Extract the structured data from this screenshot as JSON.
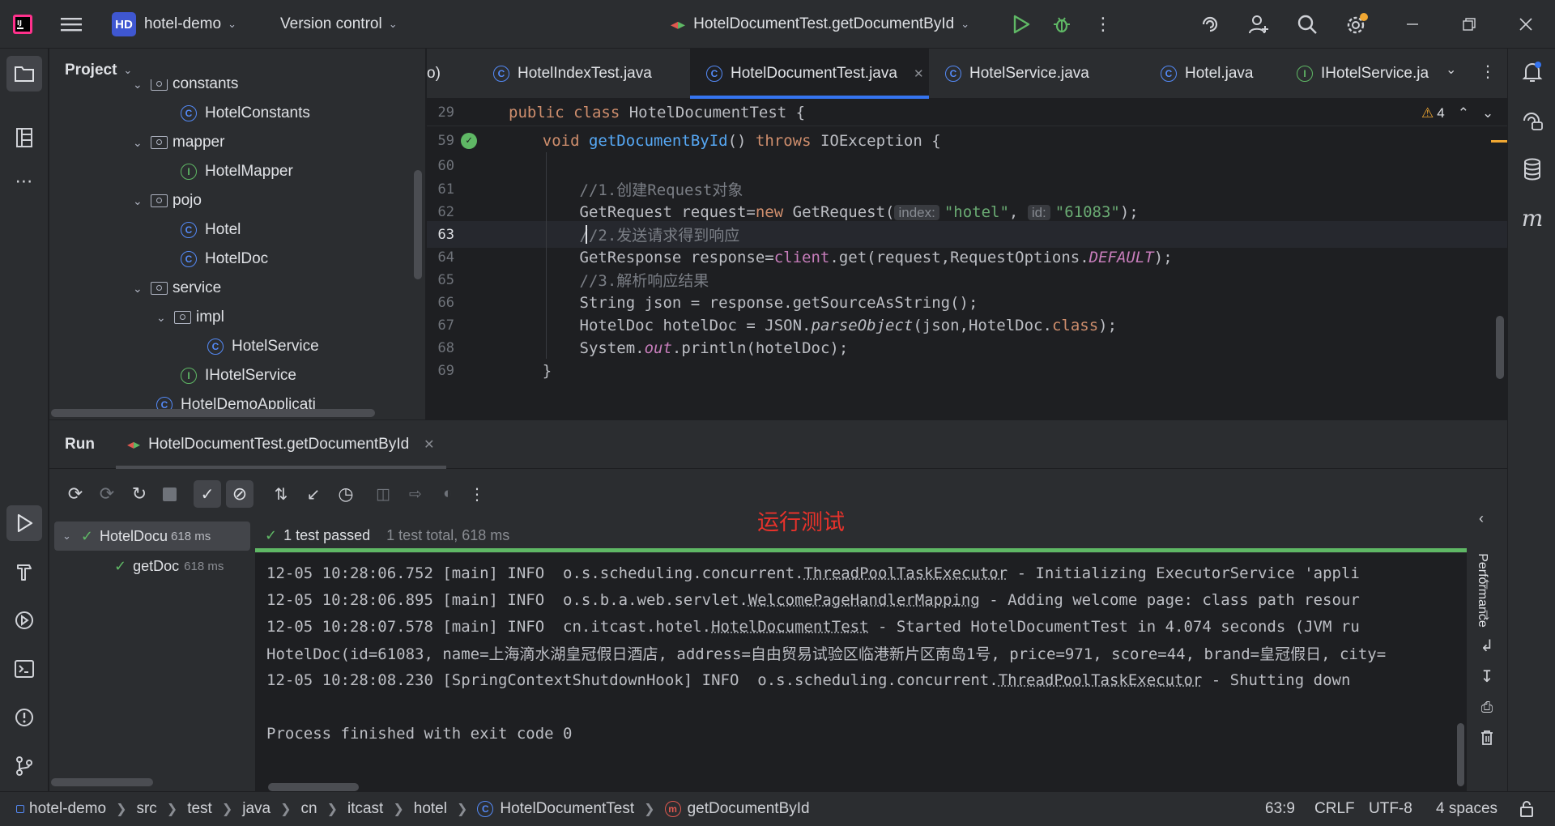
{
  "titlebar": {
    "project_badge": "HD",
    "project_name": "hotel-demo",
    "vcs_label": "Version control",
    "run_config": "HotelDocumentTest.getDocumentById"
  },
  "project_panel": {
    "title": "Project",
    "items": [
      {
        "label": "constants",
        "type": "folder",
        "indent": 0
      },
      {
        "label": "HotelConstants",
        "type": "class",
        "indent": 1
      },
      {
        "label": "mapper",
        "type": "folder",
        "indent": 0
      },
      {
        "label": "HotelMapper",
        "type": "interface",
        "indent": 1
      },
      {
        "label": "pojo",
        "type": "folder",
        "indent": 0
      },
      {
        "label": "Hotel",
        "type": "class",
        "indent": 1
      },
      {
        "label": "HotelDoc",
        "type": "class",
        "indent": 1
      },
      {
        "label": "service",
        "type": "folder",
        "indent": 0
      },
      {
        "label": "impl",
        "type": "folder",
        "indent": 1
      },
      {
        "label": "HotelService",
        "type": "class",
        "indent": 2
      },
      {
        "label": "IHotelService",
        "type": "interface",
        "indent": 1
      },
      {
        "label": "HotelDemoApplicati",
        "type": "class",
        "indent": 0
      }
    ]
  },
  "editor": {
    "tabs": [
      {
        "label": "o)"
      },
      {
        "label": "HotelIndexTest.java"
      },
      {
        "label": "HotelDocumentTest.java",
        "active": true
      },
      {
        "label": "HotelService.java"
      },
      {
        "label": "Hotel.java"
      },
      {
        "label": "IHotelService.ja"
      }
    ],
    "warnings_count": "4",
    "sticky_line": {
      "num": "29",
      "code": "public class HotelDocumentTest {"
    },
    "lines": [
      {
        "num": "59"
      },
      {
        "num": "60"
      },
      {
        "num": "61"
      },
      {
        "num": "62"
      },
      {
        "num": "63"
      },
      {
        "num": "64"
      },
      {
        "num": "65"
      },
      {
        "num": "66"
      },
      {
        "num": "67"
      },
      {
        "num": "68"
      },
      {
        "num": "69"
      }
    ],
    "code": {
      "l59_kw": "void",
      "l59_fn": "getDocumentById",
      "l59_rest1": "() ",
      "l59_throws": "throws",
      "l59_rest2": " IOException {",
      "l61": "//1.创建Request对象",
      "l62_a": "GetRequest request=",
      "l62_new": "new",
      "l62_b": " GetRequest(",
      "l62_hint1": "index:",
      "l62_s1": "\"hotel\"",
      "l62_c": ", ",
      "l62_hint2": "id:",
      "l62_s2": "\"61083\"",
      "l62_d": ");",
      "l63": "//2.发送请求得到响应",
      "l64_a": "GetResponse response=",
      "l64_client": "client",
      "l64_b": ".get(request,RequestOptions.",
      "l64_default": "DEFAULT",
      "l64_c": ");",
      "l65": "//3.解析响应结果",
      "l66": "String json = response.getSourceAsString();",
      "l67_a": "HotelDoc hotelDoc = JSON.",
      "l67_parse": "parseObject",
      "l67_b": "(json,HotelDoc.",
      "l67_class": "class",
      "l67_c": ");",
      "l68_a": "System.",
      "l68_out": "out",
      "l68_b": ".println(hotelDoc);",
      "l69": "}"
    }
  },
  "run_panel": {
    "title": "Run",
    "tab_label": "HotelDocumentTest.getDocumentById",
    "annotation": "运行测试",
    "tree": [
      {
        "label": "HotelDocu",
        "time": "618 ms"
      },
      {
        "label": "getDoc",
        "time": "618 ms"
      }
    ],
    "summary_passed": "1 test passed",
    "summary_total": "1 test total, 618 ms",
    "side_label": "Performance",
    "logs": {
      "l1_a": "12-05 10:28:06.752 [main] INFO  o.s.scheduling.concurrent.",
      "l1_u": "ThreadPoolTaskExecutor",
      "l1_b": " - Initializing ExecutorService 'appli",
      "l2_a": "12-05 10:28:06.895 [main] INFO  o.s.b.a.web.servlet.",
      "l2_u": "WelcomePageHandlerMapping",
      "l2_b": " - Adding welcome page: class path resour",
      "l3_a": "12-05 10:28:07.578 [main] INFO  cn.itcast.hotel.",
      "l3_u": "HotelDocumentTest",
      "l3_b": " - Started HotelDocumentTest in 4.074 seconds (JVM ru",
      "l4": "HotelDoc(id=61083, name=上海滴水湖皇冠假日酒店, address=自由贸易试验区临港新片区南岛1号, price=971, score=44, brand=皇冠假日, city=",
      "l5_a": "12-05 10:28:08.230 [SpringContextShutdownHook] INFO  o.s.scheduling.concurrent.",
      "l5_u": "ThreadPoolTaskExecutor",
      "l5_b": " - Shutting down",
      "l6": "Process finished with exit code 0"
    }
  },
  "statusbar": {
    "crumbs": [
      "hotel-demo",
      "src",
      "test",
      "java",
      "cn",
      "itcast",
      "hotel",
      "HotelDocumentTest",
      "getDocumentById"
    ],
    "position": "63:9",
    "line_sep": "CRLF",
    "encoding": "UTF-8",
    "indent": "4 spaces"
  },
  "colors": {
    "accent": "#3574f0",
    "success": "#5fb865",
    "annotation": "#e8322b"
  }
}
